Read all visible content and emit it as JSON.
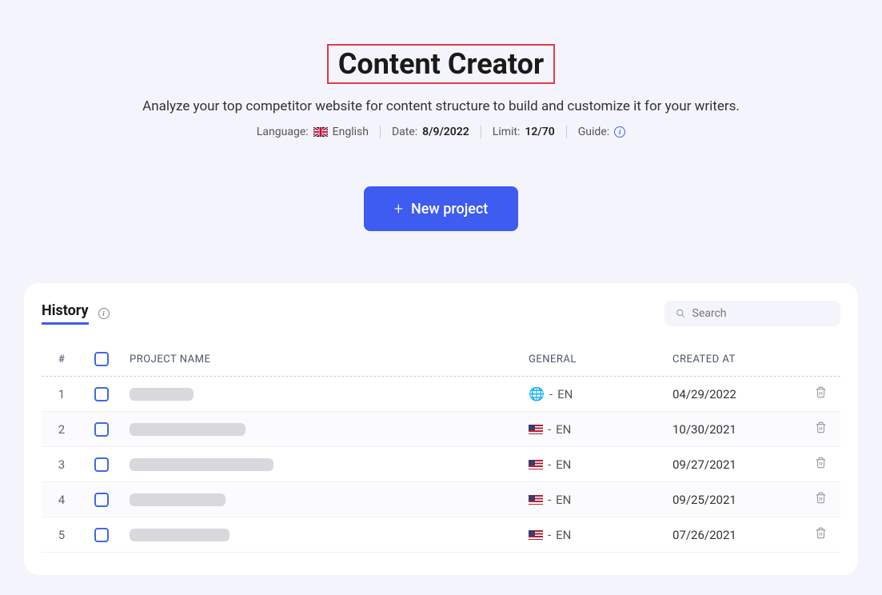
{
  "header": {
    "title": "Content Creator",
    "subtitle": "Analyze your top competitor website for content structure to build and customize it for your writers.",
    "meta": {
      "language_label": "Language:",
      "language_value": "English",
      "date_label": "Date:",
      "date_value": "8/9/2022",
      "limit_label": "Limit:",
      "limit_value": "12/70",
      "guide_label": "Guide:"
    },
    "new_project_label": "New project"
  },
  "history": {
    "title": "History",
    "search_placeholder": "Search",
    "columns": {
      "num": "#",
      "name": "PROJECT NAME",
      "general": "GENERAL",
      "created": "CREATED AT"
    },
    "rows": [
      {
        "num": "1",
        "redacted_width": 80,
        "flag": "globe",
        "lang": "EN",
        "created": "04/29/2022"
      },
      {
        "num": "2",
        "redacted_width": 145,
        "flag": "us",
        "lang": "EN",
        "created": "10/30/2021"
      },
      {
        "num": "3",
        "redacted_width": 180,
        "flag": "us",
        "lang": "EN",
        "created": "09/27/2021"
      },
      {
        "num": "4",
        "redacted_width": 120,
        "flag": "us",
        "lang": "EN",
        "created": "09/25/2021"
      },
      {
        "num": "5",
        "redacted_width": 125,
        "flag": "us",
        "lang": "EN",
        "created": "07/26/2021"
      }
    ]
  }
}
